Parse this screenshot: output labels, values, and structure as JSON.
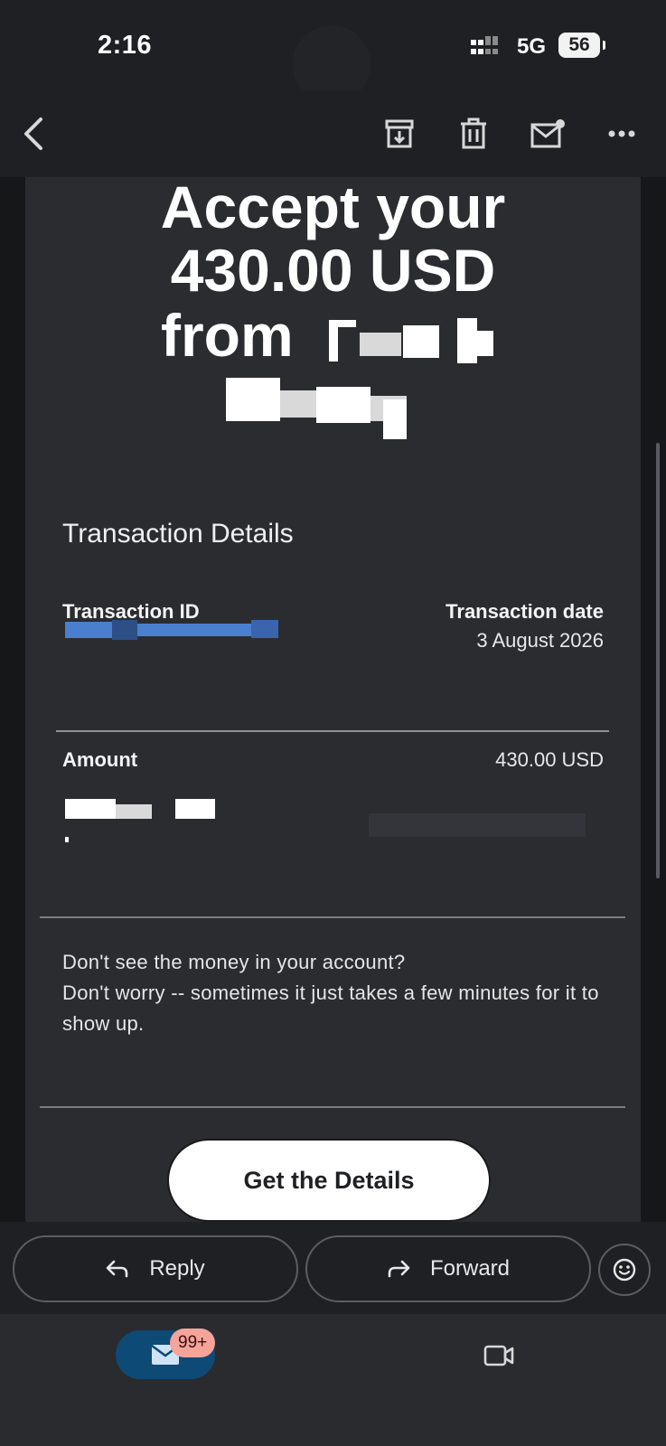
{
  "status_bar": {
    "time": "2:16",
    "network": "5G",
    "battery": "56"
  },
  "toolbar": {
    "back_icon": "chevron-left-icon",
    "archive_icon": "archive-icon",
    "delete_icon": "trash-icon",
    "mark_unread_icon": "mail-unread-icon",
    "more_icon": "more-horizontal-icon"
  },
  "email": {
    "headline_line1": "Accept your",
    "headline_line2": "430.00 USD",
    "headline_line3_prefix": "from",
    "section_title": "Transaction Details",
    "transaction_id_label": "Transaction ID",
    "transaction_date_label": "Transaction date",
    "transaction_date_value": "3 August 2026",
    "amount_label": "Amount",
    "amount_value": "430.00 USD",
    "note_line1": "Don't see the money in your account?",
    "note_line2": "Don't worry -- sometimes it just takes a few minutes for it to show up.",
    "cta_label": "Get the Details"
  },
  "actions": {
    "reply_label": "Reply",
    "forward_label": "Forward"
  },
  "bottom_nav": {
    "mail_badge": "99+"
  },
  "colors": {
    "background": "#1f2023",
    "email_card": "#2b2c30",
    "mail_tab_active": "#0e4a76",
    "badge": "#f5a49a",
    "redaction_link": "#4a7fd0"
  }
}
